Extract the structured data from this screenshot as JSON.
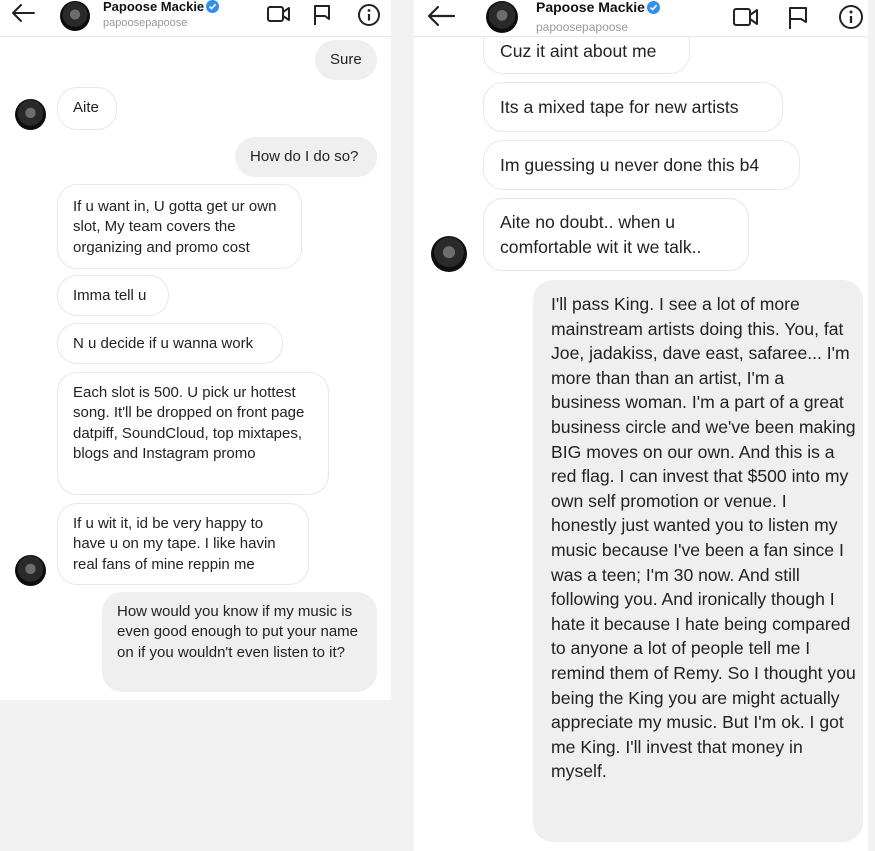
{
  "header": {
    "name": "Papoose Mackie",
    "username": "papoosepapoose"
  },
  "left": {
    "messages": [
      {
        "side": "sent",
        "text": "Sure"
      },
      {
        "side": "received",
        "text": "Aite"
      },
      {
        "side": "sent",
        "text": "How do I do so?"
      },
      {
        "side": "received",
        "text": "If u want in, U gotta get ur own slot, My team covers the organizing and  promo cost"
      },
      {
        "side": "received",
        "text": "Imma tell u"
      },
      {
        "side": "received",
        "text": "N u decide if u wanna work"
      },
      {
        "side": "received",
        "text": "Each slot is 500. U pick ur hottest song.  It'll be dropped on front page datpiff, SoundCloud, top mixtapes, blogs and Instagram promo"
      },
      {
        "side": "received",
        "text": "If u wit it, id be very happy to have u on my tape. I like havin real fans of mine reppin me"
      },
      {
        "side": "sent",
        "text": "How would you know if my music is even good enough to put your name on if you wouldn't even listen to it?"
      }
    ]
  },
  "right": {
    "messages": [
      {
        "side": "received",
        "text": "Cuz it aint about me"
      },
      {
        "side": "received",
        "text": "Its a mixed tape for new artists"
      },
      {
        "side": "received",
        "text": "Im guessing u never done this b4"
      },
      {
        "side": "received",
        "text": "Aite no doubt.. when u comfortable wit it we talk.."
      },
      {
        "side": "sent",
        "text": "I'll pass King. I see a lot of more mainstream artists doing this. You, fat Joe, jadakiss, dave east, safaree... I'm more than than an artist, I'm a business woman. I'm a part of a great business circle and we've been making BIG moves on our own. And this is a red flag. I can invest that $500 into my own self promotion or venue. I honestly just wanted you to listen my music because I've been a fan since I was a teen; I'm 30 now. And still following you. And ironically though I hate it because I hate being compared to anyone a lot of people tell me I remind them of Remy. So I thought you being the King you are might actually appreciate my music. But I'm ok. I got me King. I'll invest that money in myself."
      }
    ]
  },
  "icons": [
    "back-arrow-icon",
    "verified-badge-icon",
    "video-call-icon",
    "flag-icon",
    "info-icon"
  ],
  "colors": {
    "verified": "#2f8df5",
    "sent_bubble": "#efefef",
    "received_bubble": "#ffffff"
  }
}
